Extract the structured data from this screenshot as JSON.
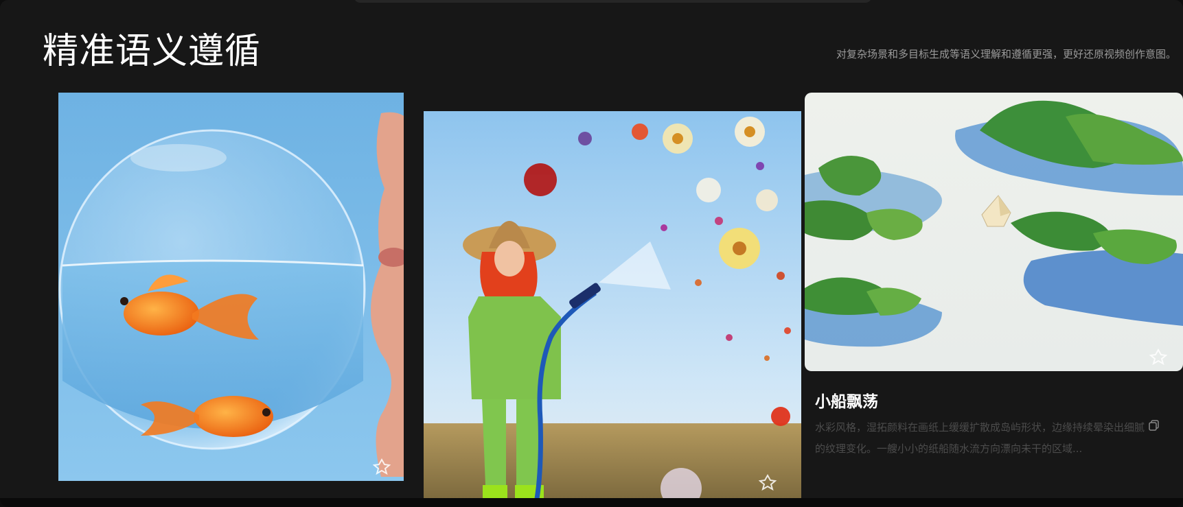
{
  "section": {
    "title": "精准语义遵循",
    "subtitle": "对复杂场景和多目标生成等语义理解和遵循更强，更好还原视频创作意图。"
  },
  "cards": [
    {
      "image": "goldfish-in-bubble",
      "watermark_icon": "brand-logo-icon"
    },
    {
      "image": "woman-spraying-flowers-from-hose",
      "watermark_icon": "brand-logo-icon"
    },
    {
      "image": "watercolor-islands-paper-boat",
      "watermark_icon": "brand-logo-icon",
      "title": "小船飘荡",
      "description": "水彩风格，湿拓颜料在画纸上缓缓扩散成岛屿形状，边缘持续晕染出细腻的纹理变化。一艘小小的纸船随水流方向漂向未干的区域...",
      "copy_icon": "copy-icon"
    }
  ],
  "colors": {
    "background": "#171717",
    "title": "#ffffff",
    "subtitle": "#9a9a9a",
    "description": "#4c4c4c"
  }
}
